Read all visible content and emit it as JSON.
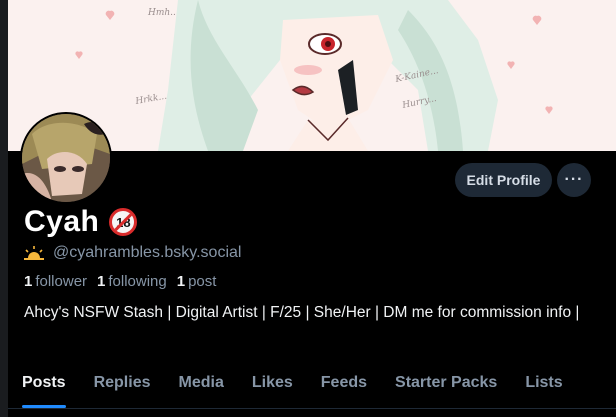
{
  "profile": {
    "display_name": "Cyah",
    "age_badge": "18",
    "handle": "@cyahrambles.bsky.social",
    "handle_icon": "sun-emoji-icon",
    "bio": "Ahcy's NSFW Stash | Digital Artist | F/25 | She/Her | DM me for commission info |"
  },
  "stats": {
    "followers_count": "1",
    "followers_label": "follower",
    "following_count": "1",
    "following_label": "following",
    "posts_count": "1",
    "posts_label": "post"
  },
  "actions": {
    "edit_profile_label": "Edit Profile",
    "more_label": "···"
  },
  "banner": {
    "scribbles": [
      "Hmh..",
      "Hrkk...",
      "K-Kaine...",
      "Hurry..."
    ]
  },
  "tabs": [
    {
      "label": "Posts",
      "active": true
    },
    {
      "label": "Replies",
      "active": false
    },
    {
      "label": "Media",
      "active": false
    },
    {
      "label": "Likes",
      "active": false
    },
    {
      "label": "Feeds",
      "active": false
    },
    {
      "label": "Starter Packs",
      "active": false
    },
    {
      "label": "Lists",
      "active": false
    }
  ],
  "colors": {
    "background": "#000000",
    "accent": "#208bfe",
    "muted_text": "#8796a7",
    "button_bg": "#1e2936",
    "badge_red": "#d92b2b"
  }
}
